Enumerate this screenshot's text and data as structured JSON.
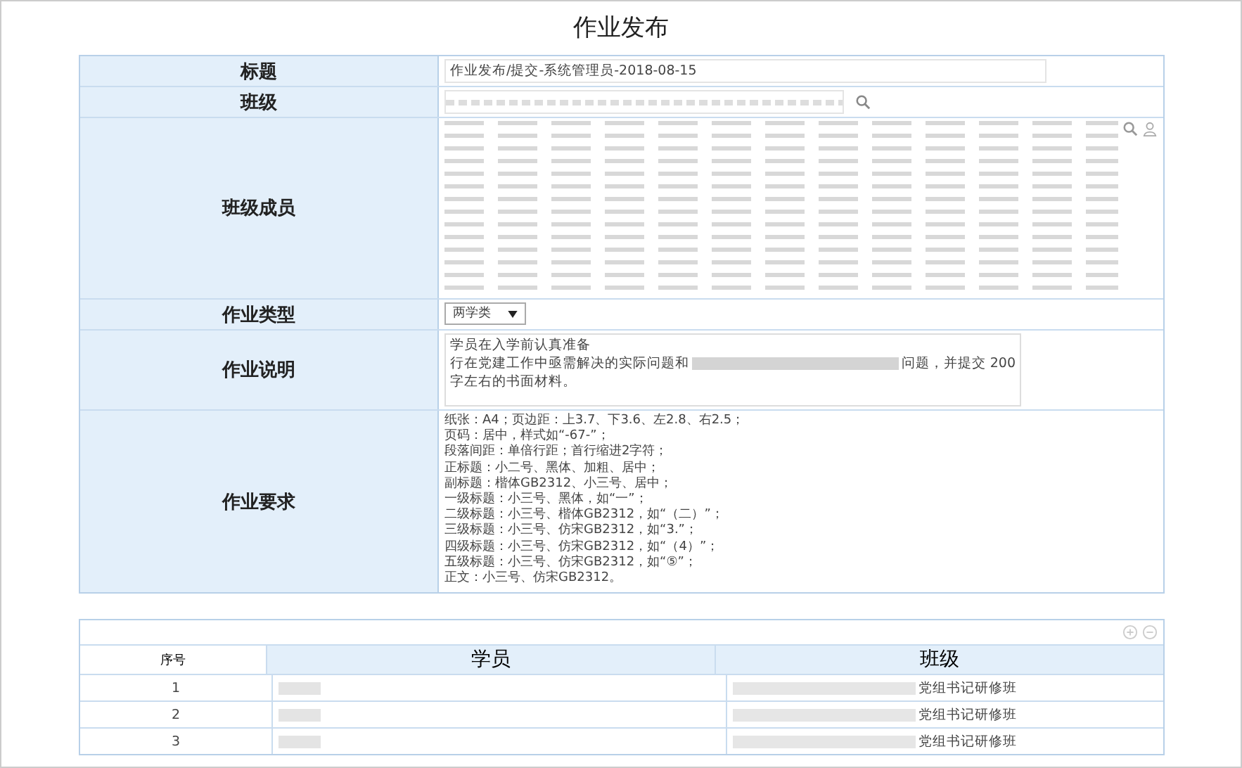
{
  "page_title": "作业发布",
  "form": {
    "fields": [
      {
        "kind": "text",
        "label": "标题",
        "value": "作业发布/提交-系统管理员-2018-08-15"
      },
      {
        "kind": "search",
        "label": "班级"
      },
      {
        "kind": "members",
        "label": "班级成员"
      },
      {
        "kind": "select",
        "label": "作业类型",
        "value": "两学类"
      },
      {
        "kind": "textarea",
        "label": "作业说明",
        "lines": [
          [
            "学员在入学前认真准备"
          ],
          [
            "行在党建工作中亟需解决的实际问题和",
            "问题，并提交 200"
          ],
          [
            "字左右的书面材料。"
          ]
        ]
      },
      {
        "kind": "lines",
        "label": "作业要求",
        "lines": [
          "纸张：A4；页边距：上3.7、下3.6、左2.8、右2.5；",
          "页码：居中，样式如“-67-”；",
          "段落间距：单倍行距；首行缩进2字符；",
          "正标题：小二号、黑体、加粗、居中；",
          "副标题：楷体GB2312、小三号、居中；",
          "一级标题：小三号、黑体，如“一”；",
          "二级标题：小三号、楷体GB2312，如“（二）”；",
          "三级标题：小三号、仿宋GB2312，如“3.”；",
          "四级标题：小三号、仿宋GB2312，如“（4）”；",
          "五级标题：小三号、仿宋GB2312，如“⑤”；",
          "正文：小三号、仿宋GB2312。"
        ]
      }
    ]
  },
  "table": {
    "columns": [
      "序号",
      "学员",
      "班级"
    ],
    "rows": [
      {
        "index": "1",
        "class": "党组书记研修班"
      },
      {
        "index": "2",
        "class": "党组书记研修班"
      },
      {
        "index": "3",
        "class": "党组书记研修班"
      }
    ]
  }
}
